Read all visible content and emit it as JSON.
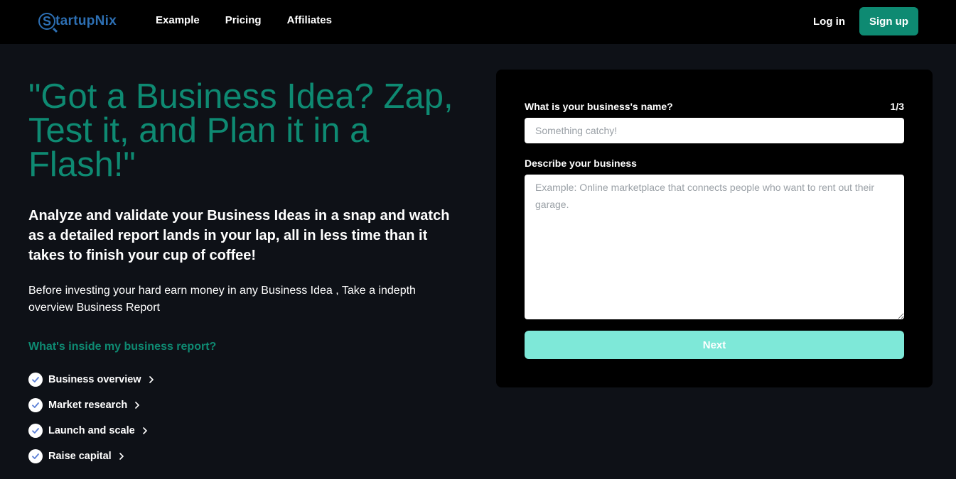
{
  "header": {
    "brand_initial": "S",
    "brand_rest": "tartupNix",
    "nav": [
      {
        "label": "Example"
      },
      {
        "label": "Pricing"
      },
      {
        "label": "Affiliates"
      }
    ],
    "login_label": "Log in",
    "signup_label": "Sign up"
  },
  "hero": {
    "title": "\"Got a Business Idea? Zap, Test it, and Plan it in a Flash!\"",
    "subtitle": "Analyze and validate your Business Ideas in a snap and watch as a detailed report lands in your lap, all in less time than it takes to finish your cup of coffee!",
    "description": "Before investing your hard earn money in any Business Idea , Take a indepth overview Business Report",
    "report_heading": "What's inside my business report?",
    "report_items": [
      {
        "label": "Business overview"
      },
      {
        "label": "Market research"
      },
      {
        "label": "Launch and scale"
      },
      {
        "label": "Raise capital"
      }
    ]
  },
  "form": {
    "name_label": "What is your business's name?",
    "step": "1/3",
    "name_placeholder": "Something catchy!",
    "name_value": "",
    "desc_label": "Describe your business",
    "desc_placeholder": "Example: Online marketplace that connects people who want to rent out their garage.",
    "desc_value": "",
    "next_label": "Next"
  },
  "colors": {
    "accent": "#0e8a72",
    "brand_blue": "#2d6fb3",
    "next_button": "#7ee8d8",
    "page_bg": "#0e1117"
  },
  "icons": {
    "check": "check-circle-icon",
    "chevron": "chevron-right-icon",
    "logo": "magnifier-logo-icon"
  }
}
